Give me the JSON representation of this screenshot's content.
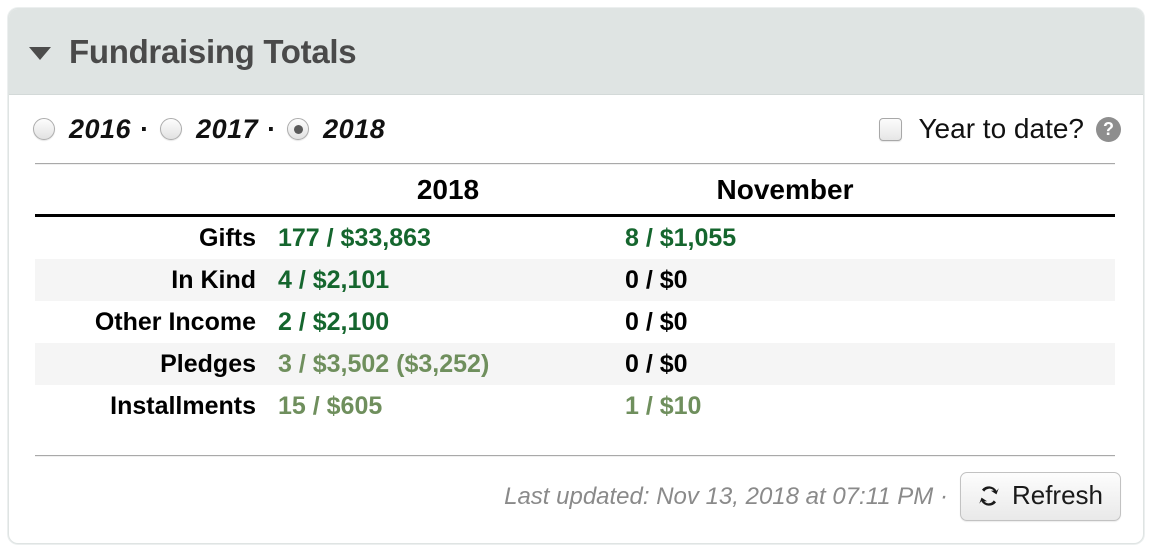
{
  "panel": {
    "title": "Fundraising Totals",
    "collapse_icon": "triangle-down-icon"
  },
  "controls": {
    "years": [
      {
        "label": "2016",
        "selected": false
      },
      {
        "label": "2017",
        "selected": false
      },
      {
        "label": "2018",
        "selected": true
      }
    ],
    "separator": "·",
    "year_to_date": {
      "label": "Year to date?",
      "checked": false,
      "help_icon": "question-mark-icon",
      "help_glyph": "?"
    }
  },
  "table": {
    "headers": {
      "label_col": "",
      "col1": "2018",
      "col2": "November"
    },
    "rows": [
      {
        "label": "Gifts",
        "col1": "177 / $33,863",
        "col1_style": "v-green",
        "col2": "8 / $1,055",
        "col2_style": "v-green"
      },
      {
        "label": "In Kind",
        "col1": "4 / $2,101",
        "col1_style": "v-green",
        "col2": "0 / $0",
        "col2_style": "v-zero"
      },
      {
        "label": "Other Income",
        "col1": "2 / $2,100",
        "col1_style": "v-green",
        "col2": "0 / $0",
        "col2_style": "v-zero"
      },
      {
        "label": "Pledges",
        "col1": "3 / $3,502 ($3,252)",
        "col1_style": "v-muted",
        "col2": "0 / $0",
        "col2_style": "v-zero"
      },
      {
        "label": "Installments",
        "col1": "15 / $605",
        "col1_style": "v-muted",
        "col2": "1 / $10",
        "col2_style": "v-muted"
      }
    ]
  },
  "footer": {
    "last_updated": "Last updated: Nov 13, 2018 at 07:11 PM ·",
    "refresh_label": "Refresh",
    "refresh_icon": "refresh-icon"
  },
  "colors": {
    "header_bg": "#dfe4e3",
    "title": "#4a4a4a",
    "value_green": "#15662e",
    "value_muted_green": "#6f8f5d",
    "row_alt_bg": "#f5f5f5",
    "rule": "#a9a9a9"
  }
}
